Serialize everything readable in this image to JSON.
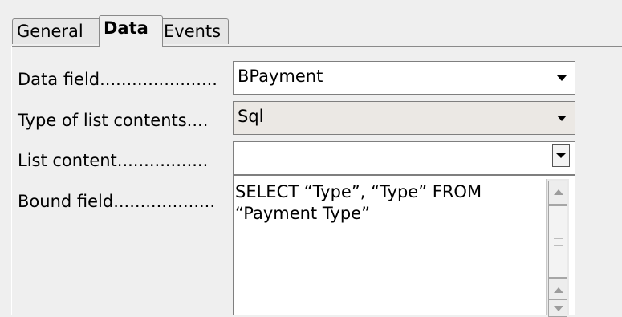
{
  "tabs": [
    {
      "label": "General",
      "active": false
    },
    {
      "label": "Data",
      "active": true
    },
    {
      "label": "Events",
      "active": false
    }
  ],
  "fields": {
    "data_field": {
      "label": "Data field......................",
      "value": "BPayment"
    },
    "type_of_list_contents": {
      "label": "Type of list contents....",
      "value": "Sql"
    },
    "list_content": {
      "label": "List content.................",
      "value": ""
    },
    "bound_field": {
      "label": "Bound field..................."
    }
  },
  "list_content_dropdown": {
    "line1": "SELECT “Type”, “Type” FROM",
    "line2": "“Payment Type”"
  }
}
